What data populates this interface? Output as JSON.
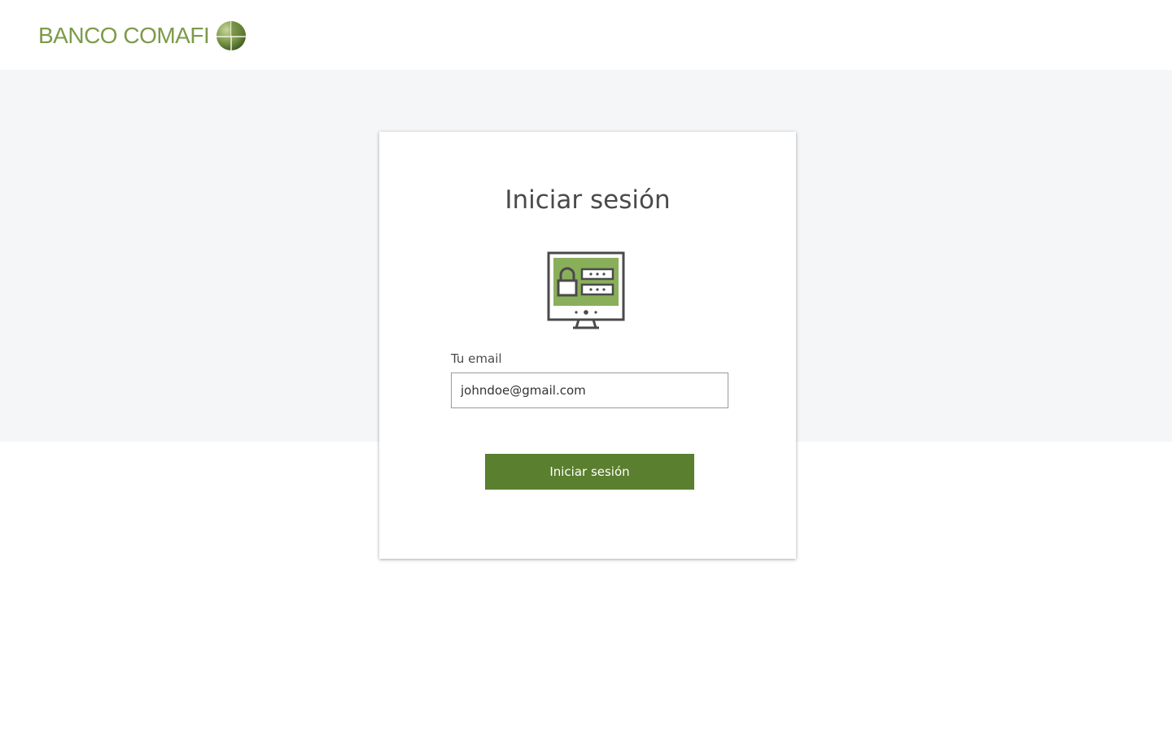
{
  "header": {
    "brand_name": "BANCO COMAFI",
    "brand_color": "#7d9a4a",
    "logo_icon": "globe-logo-icon"
  },
  "login": {
    "title": "Iniciar sesión",
    "illustration_icon": "secure-login-monitor-icon",
    "email_label": "Tu email",
    "email_value": "johndoe@gmail.com",
    "submit_label": "Iniciar sesión",
    "button_color": "#5a7f2e",
    "illustration_accent": "#8aaf5a"
  }
}
